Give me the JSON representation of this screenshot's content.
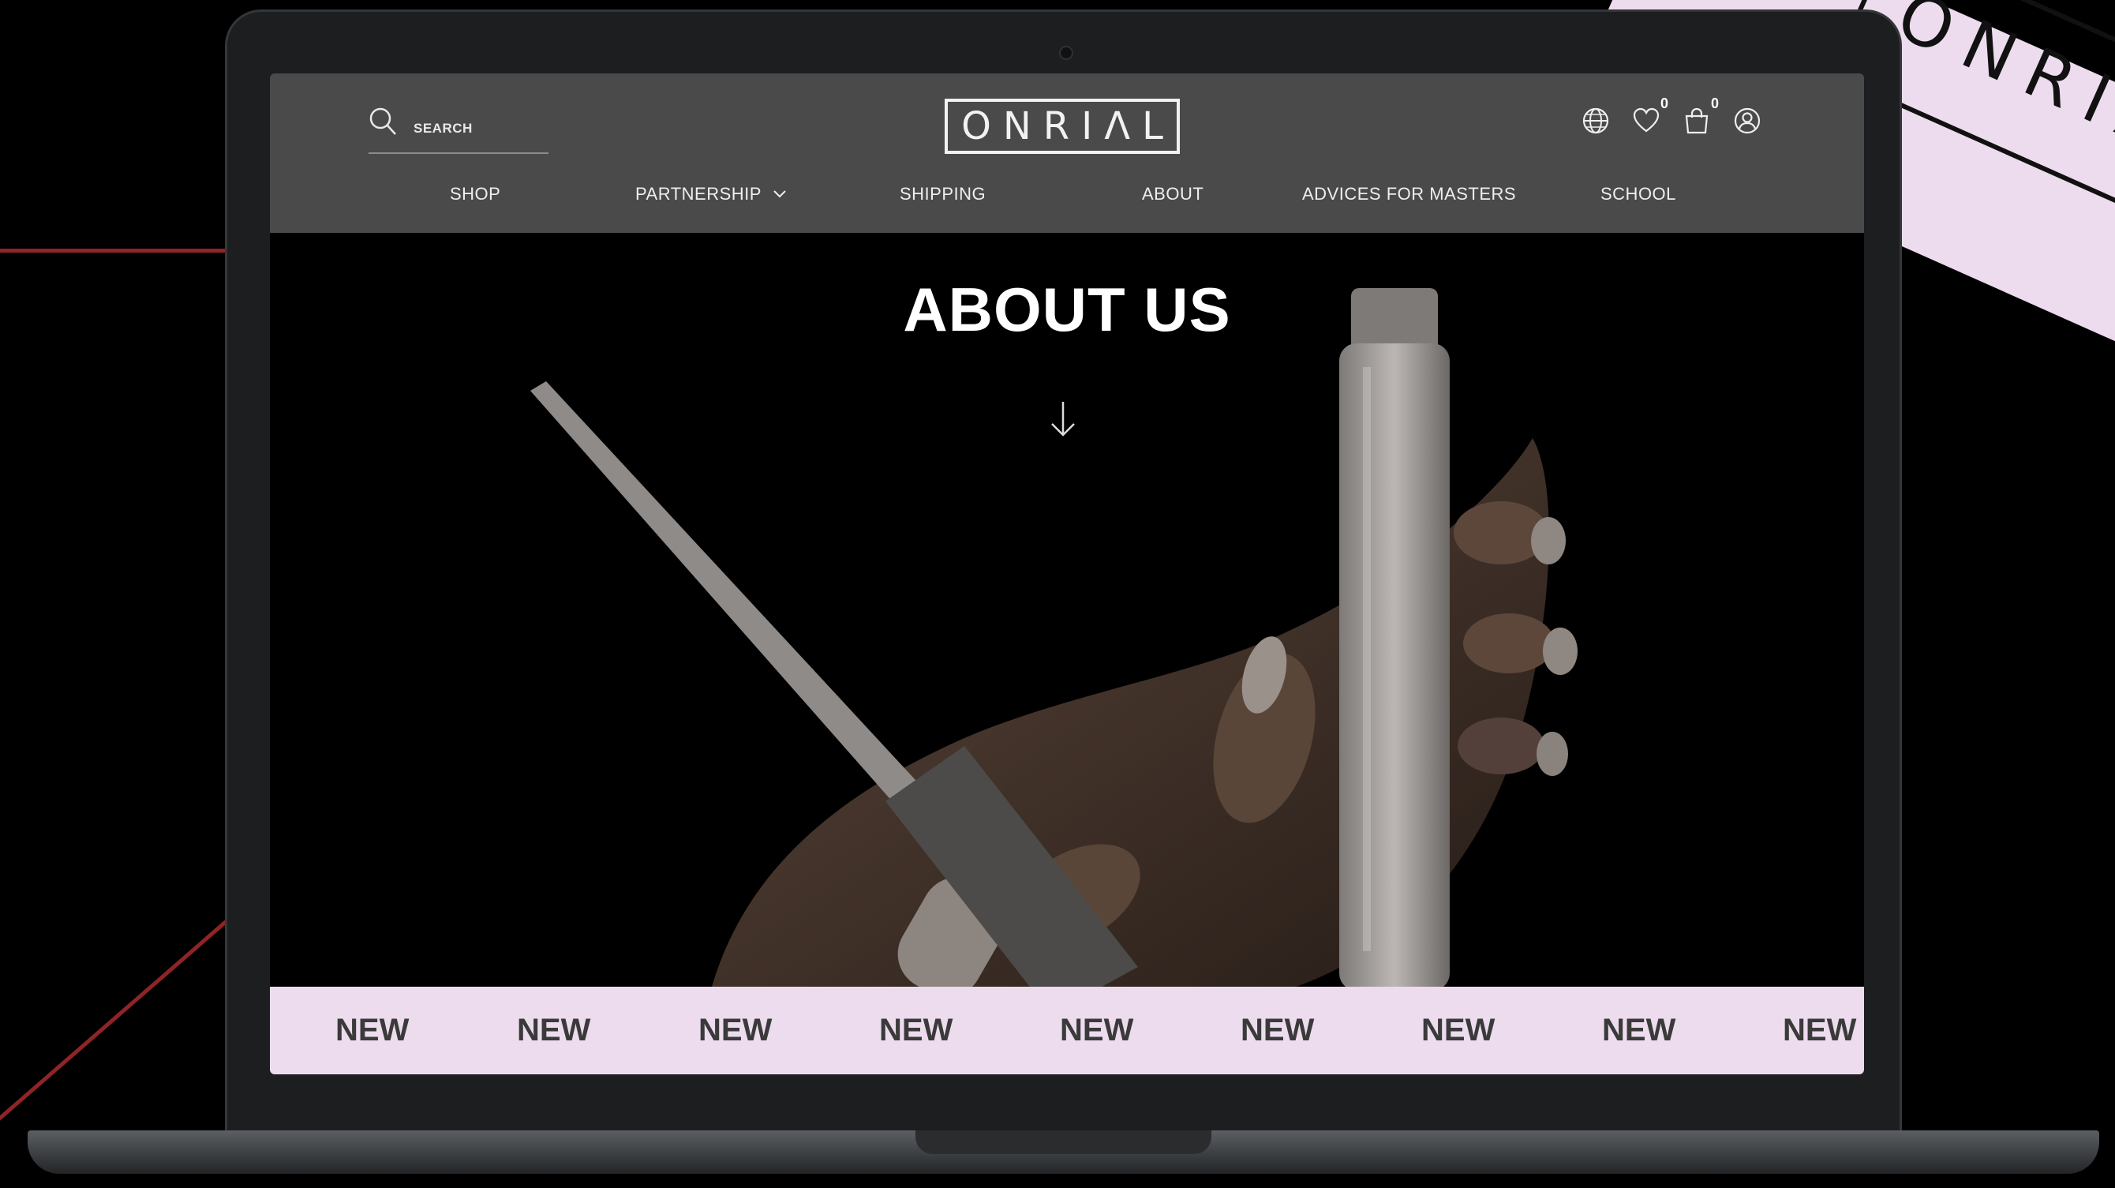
{
  "brand": {
    "logo_text": "ONRIΛL",
    "corner_text": "ONRIΛL",
    "accent": "#ecdcee",
    "line_color": "#8f2426"
  },
  "search": {
    "label": "SEARCH"
  },
  "header": {
    "icons": [
      {
        "name": "globe-icon",
        "badge": ""
      },
      {
        "name": "heart-icon",
        "badge": "0"
      },
      {
        "name": "bag-icon",
        "badge": "0"
      },
      {
        "name": "user-icon",
        "badge": ""
      }
    ],
    "nav": [
      {
        "label": "SHOP"
      },
      {
        "label": "PARTNERSHIP",
        "has_dropdown": true
      },
      {
        "label": "SHIPPING"
      },
      {
        "label": "ABOUT"
      },
      {
        "label": "ADVICES FOR MASTERS"
      },
      {
        "label": "SCHOOL"
      }
    ]
  },
  "hero": {
    "title": "ABOUT US",
    "scroll_icon": "arrow-down-icon"
  },
  "ticker": {
    "items": [
      "NEW",
      "NEW",
      "NEW",
      "NEW",
      "NEW",
      "NEW",
      "NEW",
      "NEW",
      "NEW"
    ]
  }
}
